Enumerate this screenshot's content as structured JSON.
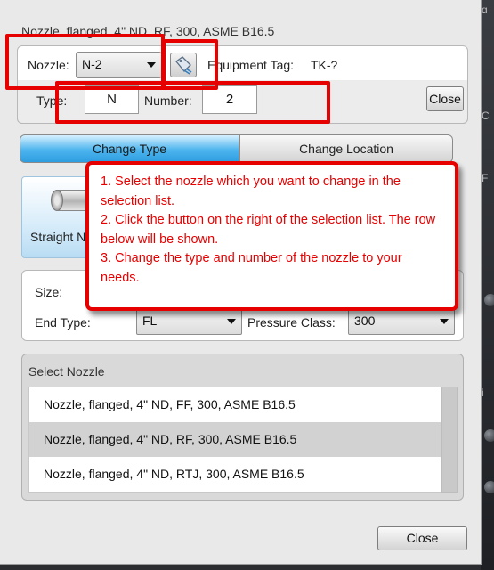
{
  "dialog": {
    "title": "Nozzle, flanged, 4\" ND, RF, 300, ASME B16.5"
  },
  "top_panel": {
    "nozzle_label": "Nozzle:",
    "nozzle_value": "N-2",
    "equipment_tag_label": "Equipment Tag:",
    "equipment_tag_value": "TK-?",
    "type_label": "Type:",
    "type_value": "N",
    "number_label": "Number:",
    "number_value": "2",
    "close_label": "Close"
  },
  "tabs": [
    {
      "label": "Change Type",
      "active": true
    },
    {
      "label": "Change Location",
      "active": false
    }
  ],
  "nozzle_type_tile": {
    "label": "Straight N"
  },
  "properties": {
    "size_label": "Size:",
    "end_type_label": "End Type:",
    "end_type_value": "FL",
    "pressure_class_label": "Pressure Class:",
    "pressure_class_value": "300"
  },
  "select_nozzle": {
    "header": "Select Nozzle",
    "items": [
      {
        "label": "Nozzle, flanged, 4\" ND, FF, 300, ASME B16.5",
        "selected": false
      },
      {
        "label": "Nozzle, flanged, 4\" ND, RF, 300, ASME B16.5",
        "selected": true
      },
      {
        "label": "Nozzle, flanged, 4\" ND, RTJ, 300, ASME B16.5",
        "selected": false
      }
    ]
  },
  "footer": {
    "close_label": "Close"
  },
  "callout": {
    "lines": [
      "1. Select the nozzle which you want to change in the selection list.",
      "2. Click the button on the right of the selection list. The row below will be shown.",
      "3. Change the type and number of the nozzle to your needs."
    ]
  },
  "background_fragments": {
    "fragment_1": "ɑ",
    "fragment_2": "C",
    "fragment_3": "F",
    "fragment_4": "i"
  },
  "colors": {
    "annotation_red": "#e60000",
    "active_tab_blue": "#2e9de0",
    "dialog_background": "#e9e9e9"
  },
  "icons": {
    "edit_nozzle_button": "tag-edit-icon",
    "dropdown": "chevron-down-icon"
  }
}
